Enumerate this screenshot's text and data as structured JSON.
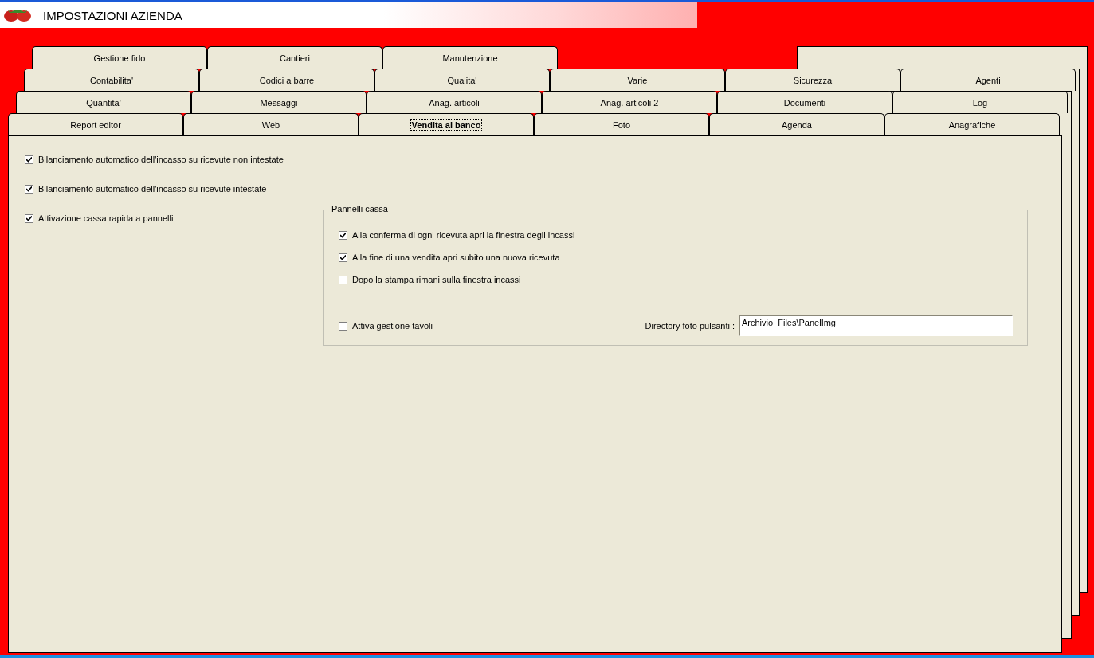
{
  "window": {
    "title": "IMPOSTAZIONI AZIENDA"
  },
  "tab_rows": [
    [
      {
        "label": "Gestione fido",
        "selected": false
      },
      {
        "label": "Cantieri",
        "selected": false
      },
      {
        "label": "Manutenzione",
        "selected": false
      }
    ],
    [
      {
        "label": "Contabilita'",
        "selected": false
      },
      {
        "label": "Codici a barre",
        "selected": false
      },
      {
        "label": "Qualita'",
        "selected": false
      },
      {
        "label": "Varie",
        "selected": false
      },
      {
        "label": "Sicurezza",
        "selected": false
      },
      {
        "label": "Agenti",
        "selected": false
      }
    ],
    [
      {
        "label": "Quantita'",
        "selected": false
      },
      {
        "label": "Messaggi",
        "selected": false
      },
      {
        "label": "Anag. articoli",
        "selected": false
      },
      {
        "label": "Anag. articoli 2",
        "selected": false
      },
      {
        "label": "Documenti",
        "selected": false
      },
      {
        "label": "Log",
        "selected": false
      }
    ],
    [
      {
        "label": "Report editor",
        "selected": false
      },
      {
        "label": "Web",
        "selected": false
      },
      {
        "label": "Vendita al banco",
        "selected": true
      },
      {
        "label": "Foto",
        "selected": false
      },
      {
        "label": "Agenda",
        "selected": false
      },
      {
        "label": "Anagrafiche",
        "selected": false
      }
    ]
  ],
  "options": [
    {
      "label": "Bilanciamento automatico dell'incasso su ricevute non intestate",
      "checked": true
    },
    {
      "label": "Bilanciamento automatico dell'incasso su ricevute intestate",
      "checked": true
    },
    {
      "label": "Attivazione cassa rapida a pannelli",
      "checked": true
    }
  ],
  "group": {
    "title": "Pannelli cassa",
    "options": [
      {
        "label": "Alla conferma di ogni ricevuta apri la finestra degli incassi",
        "checked": true
      },
      {
        "label": "Alla fine di una vendita apri subito una nuova ricevuta",
        "checked": true
      },
      {
        "label": "Dopo la stampa rimani sulla finestra incassi",
        "checked": false
      }
    ],
    "table_option": {
      "label": "Attiva gestione tavoli",
      "checked": false
    },
    "directory_field": {
      "label": "Directory foto pulsanti :",
      "value": "Archivio_Files\\PanelImg"
    }
  }
}
